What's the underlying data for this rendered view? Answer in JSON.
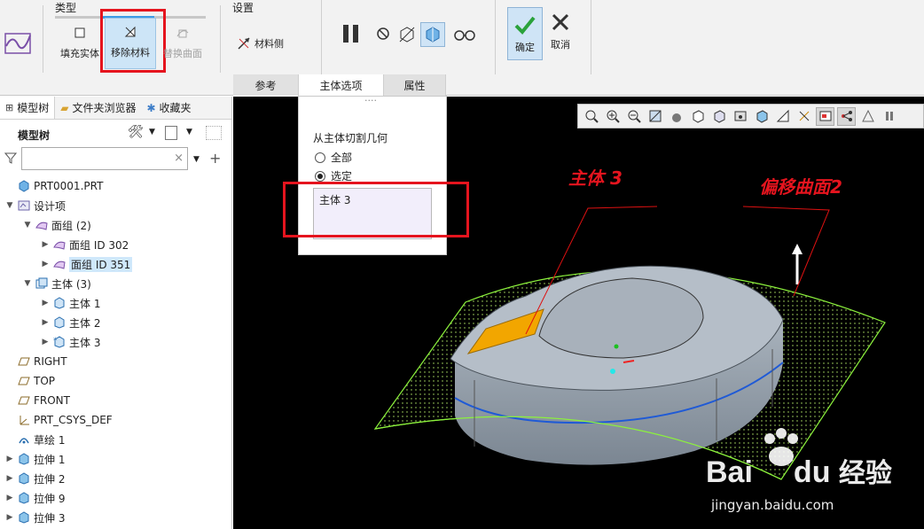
{
  "ribbon": {
    "type_group": "类型",
    "settings_group": "设置",
    "fill_solid": "填充实体",
    "remove_material": "移除材料",
    "replace_surface": "替换曲面",
    "material_side": "材料侧",
    "ok": "确定",
    "cancel": "取消",
    "tabs": [
      "参考",
      "主体选项",
      "属性"
    ]
  },
  "panel": {
    "tabs": [
      "模型树",
      "文件夹浏览器",
      "收藏夹"
    ],
    "tree_header": "模型树",
    "filter_placeholder": "",
    "filter_clear": "×"
  },
  "tree": [
    {
      "label": "PRT0001.PRT",
      "indent": 0,
      "icon": "part-icon",
      "twisty": ""
    },
    {
      "label": "设计项",
      "indent": 0,
      "icon": "design-items-icon",
      "twisty": "▼"
    },
    {
      "label": "面组 (2)",
      "indent": 1,
      "icon": "quilt-group-icon",
      "twisty": "▼"
    },
    {
      "label": "面组 ID 302",
      "indent": 2,
      "icon": "quilt-icon",
      "twisty": "▶"
    },
    {
      "label": "面组 ID 351",
      "indent": 2,
      "icon": "quilt-icon",
      "twisty": "▶",
      "selected": true
    },
    {
      "label": "主体 (3)",
      "indent": 1,
      "icon": "body-group-icon",
      "twisty": "▼"
    },
    {
      "label": "主体 1",
      "indent": 2,
      "icon": "body-icon",
      "twisty": "▶"
    },
    {
      "label": "主体 2",
      "indent": 2,
      "icon": "body-icon",
      "twisty": "▶"
    },
    {
      "label": "主体 3",
      "indent": 2,
      "icon": "body-new-icon",
      "twisty": "▶"
    },
    {
      "label": "RIGHT",
      "indent": 0,
      "icon": "datum-plane-icon",
      "twisty": ""
    },
    {
      "label": "TOP",
      "indent": 0,
      "icon": "datum-plane-icon",
      "twisty": ""
    },
    {
      "label": "FRONT",
      "indent": 0,
      "icon": "datum-plane-icon",
      "twisty": ""
    },
    {
      "label": "PRT_CSYS_DEF",
      "indent": 0,
      "icon": "csys-icon",
      "twisty": ""
    },
    {
      "label": "草绘 1",
      "indent": 0,
      "icon": "sketch-icon",
      "twisty": ""
    },
    {
      "label": "拉伸 1",
      "indent": 0,
      "icon": "extrude-icon",
      "twisty": "▶"
    },
    {
      "label": "拉伸 2",
      "indent": 0,
      "icon": "extrude-icon",
      "twisty": "▶"
    },
    {
      "label": "拉伸 9",
      "indent": 0,
      "icon": "extrude-icon",
      "twisty": "▶"
    },
    {
      "label": "拉伸 3",
      "indent": 0,
      "icon": "extrude-icon",
      "twisty": "▶"
    }
  ],
  "dash": {
    "dots": "····",
    "title": "从主体切割几何",
    "opt_all": "全部",
    "opt_selected": "选定",
    "selected_body": "主体 3"
  },
  "annotations": {
    "body3": "主体 3",
    "offset": "偏移曲面2"
  },
  "watermark": {
    "logo_b": "Bai",
    "logo_du": "du",
    "cn": "经验",
    "url": "jingyan.baidu.com"
  },
  "colors": {
    "accent": "#3d9be6",
    "highlight_red": "#e5141e",
    "ok_green": "#2aa23b",
    "body_orange": "#f2a600",
    "surface_green": "#8cf23c"
  }
}
